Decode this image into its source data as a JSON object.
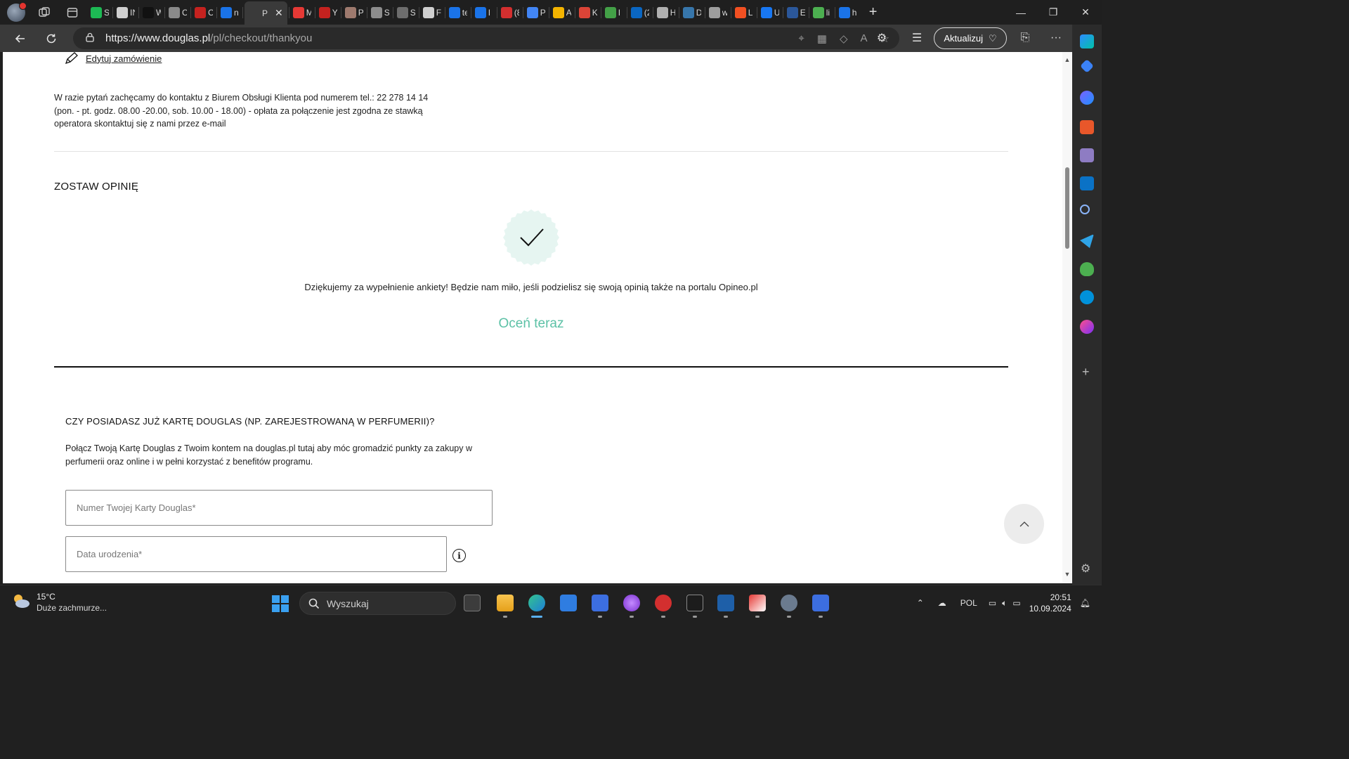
{
  "browser": {
    "tabs": [
      {
        "label": "S",
        "color": "#1db954"
      },
      {
        "label": "IN",
        "color": "#cfcfcf"
      },
      {
        "label": "W",
        "color": "#111111"
      },
      {
        "label": "C",
        "color": "#8a8a8a"
      },
      {
        "label": "C",
        "color": "#c5221f"
      },
      {
        "label": "n",
        "color": "#1a73e8"
      },
      {
        "label": "P",
        "color": "#3a3a3a",
        "active": true
      },
      {
        "label": "M",
        "color": "#e53935"
      },
      {
        "label": "Y",
        "color": "#c5221f"
      },
      {
        "label": "P",
        "color": "#9e7a6e"
      },
      {
        "label": "S",
        "color": "#8d8d8d"
      },
      {
        "label": "S",
        "color": "#6d6d6d"
      },
      {
        "label": "F",
        "color": "#cfcfcf"
      },
      {
        "label": "te",
        "color": "#1a73e8"
      },
      {
        "label": "I",
        "color": "#1a73e8"
      },
      {
        "label": "(8",
        "color": "#d32f2f"
      },
      {
        "label": "P",
        "color": "#4285f4"
      },
      {
        "label": "A",
        "color": "#f4b400"
      },
      {
        "label": "K",
        "color": "#db4437"
      },
      {
        "label": "I",
        "color": "#43a047"
      },
      {
        "label": "(2",
        "color": "#0a66c2"
      },
      {
        "label": "H",
        "color": "#b0b0b0"
      },
      {
        "label": "D",
        "color": "#3776ab"
      },
      {
        "label": "w",
        "color": "#9e9e9e"
      },
      {
        "label": "L",
        "color": "#f25022"
      },
      {
        "label": "U",
        "color": "#1877f2"
      },
      {
        "label": "E",
        "color": "#2b579a"
      },
      {
        "label": "li",
        "color": "#4caf50"
      },
      {
        "label": "h",
        "color": "#1a73e8"
      }
    ],
    "active_tab_close": "✕",
    "url_host": "https://www.douglas.pl",
    "url_path": "/pl/checkout/thankyou",
    "update_button": "Aktualizuj"
  },
  "page": {
    "edit_order_link": "Edytuj zamówienie",
    "contact_text": "W razie pytań zachęcamy do kontaktu z Biurem Obsługi Klienta pod numerem tel.: 22 278 14 14 (pon. - pt. godz. 08.00 -20.00, sob. 10.00 - 18.00) - opłata za połączenie jest zgodna ze stawką operatora skontaktuj się z nami przez e-mail",
    "review_heading": "ZOSTAW OPINIĘ",
    "thanks_text": "Dziękujemy za wypełnienie ankiety! Będzie nam miło, jeśli podzielisz się swoją opinią także na portalu Opineo.pl",
    "rate_now": "Oceń teraz",
    "card_heading": "CZY POSIADASZ JUŻ KARTĘ DOUGLAS (NP. ZAREJESTROWANĄ W PERFUMERII)?",
    "card_text": "Połącz Twoją Kartę Douglas z Twoim kontem na douglas.pl tutaj aby móc gromadzić punkty za zakupy w perfumerii oraz online i w pełni korzystać z benefitów programu.",
    "card_number_placeholder": "Numer Twojej Karty Douglas*",
    "birthdate_placeholder": "Data urodzenia*",
    "info_glyph": "i",
    "accent_color": "#5cc1a6"
  },
  "taskbar": {
    "weather_temp": "15°C",
    "weather_desc": "Duże zachmurze...",
    "search_placeholder": "Wyszukaj",
    "language": "POL",
    "time": "20:51",
    "date": "10.09.2024"
  }
}
